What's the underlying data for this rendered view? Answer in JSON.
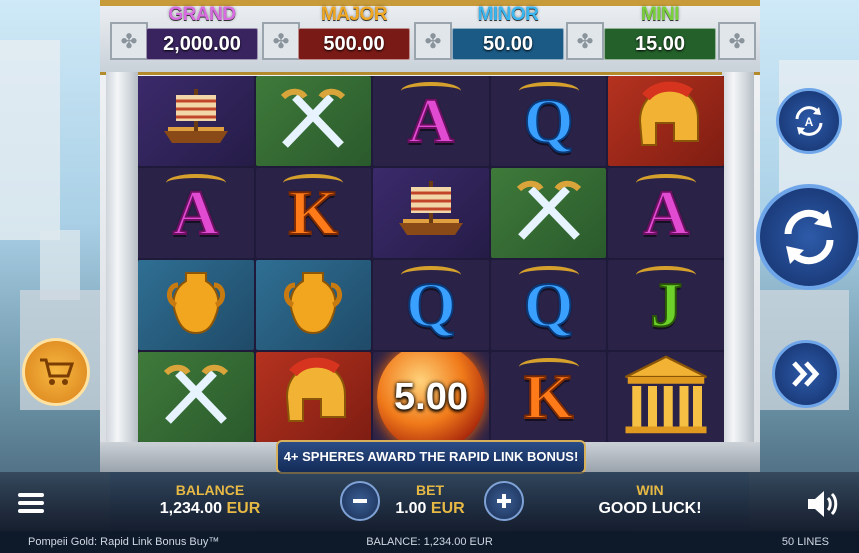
{
  "jackpots": [
    {
      "label": "GRAND",
      "value": "2,000.00",
      "label_color": "#d86be0",
      "box_color": "#3a2460"
    },
    {
      "label": "MAJOR",
      "value": "500.00",
      "label_color": "#f0a823",
      "box_color": "#7a1a16"
    },
    {
      "label": "MINOR",
      "value": "50.00",
      "label_color": "#39b5f0",
      "box_color": "#1a5a85"
    },
    {
      "label": "MINI",
      "value": "15.00",
      "label_color": "#7ad23b",
      "box_color": "#23602a"
    }
  ],
  "reels": [
    [
      {
        "type": "ship",
        "bg": "purple"
      },
      {
        "type": "A",
        "bg": "dark"
      },
      {
        "type": "vase",
        "bg": "blue"
      },
      {
        "type": "swords",
        "bg": "green"
      }
    ],
    [
      {
        "type": "swords",
        "bg": "green"
      },
      {
        "type": "K",
        "bg": "dark"
      },
      {
        "type": "vase",
        "bg": "blue"
      },
      {
        "type": "helmet",
        "bg": "red"
      }
    ],
    [
      {
        "type": "A",
        "bg": "dark"
      },
      {
        "type": "ship",
        "bg": "purple"
      },
      {
        "type": "Q",
        "bg": "dark"
      },
      {
        "type": "sphere",
        "bg": "dark",
        "value": "5.00"
      }
    ],
    [
      {
        "type": "Q",
        "bg": "dark"
      },
      {
        "type": "swords",
        "bg": "green"
      },
      {
        "type": "Q",
        "bg": "dark"
      },
      {
        "type": "K",
        "bg": "dark"
      }
    ],
    [
      {
        "type": "helmet",
        "bg": "red"
      },
      {
        "type": "A",
        "bg": "dark"
      },
      {
        "type": "J",
        "bg": "dark"
      },
      {
        "type": "temple",
        "bg": "dark"
      }
    ]
  ],
  "banner": "4+ SPHERES AWARD THE RAPID LINK BONUS!",
  "controls": {
    "balance_label": "BALANCE",
    "balance_value": "1,234.00",
    "balance_currency": "EUR",
    "bet_label": "BET",
    "bet_value": "1.00",
    "bet_currency": "EUR",
    "win_label": "WIN",
    "win_value": "GOOD LUCK!"
  },
  "status": {
    "game_title": "Pompeii Gold: Rapid Link Bonus Buy™",
    "balance": "BALANCE: 1,234.00 EUR",
    "lines": "50 LINES"
  },
  "icons": {
    "autoplay": "autoplay-icon",
    "spin": "spin-icon",
    "turbo": "fast-forward-icon",
    "buy": "cart-icon",
    "menu": "menu-icon",
    "sound": "speaker-icon",
    "bet_minus": "minus-icon",
    "bet_plus": "plus-icon"
  }
}
